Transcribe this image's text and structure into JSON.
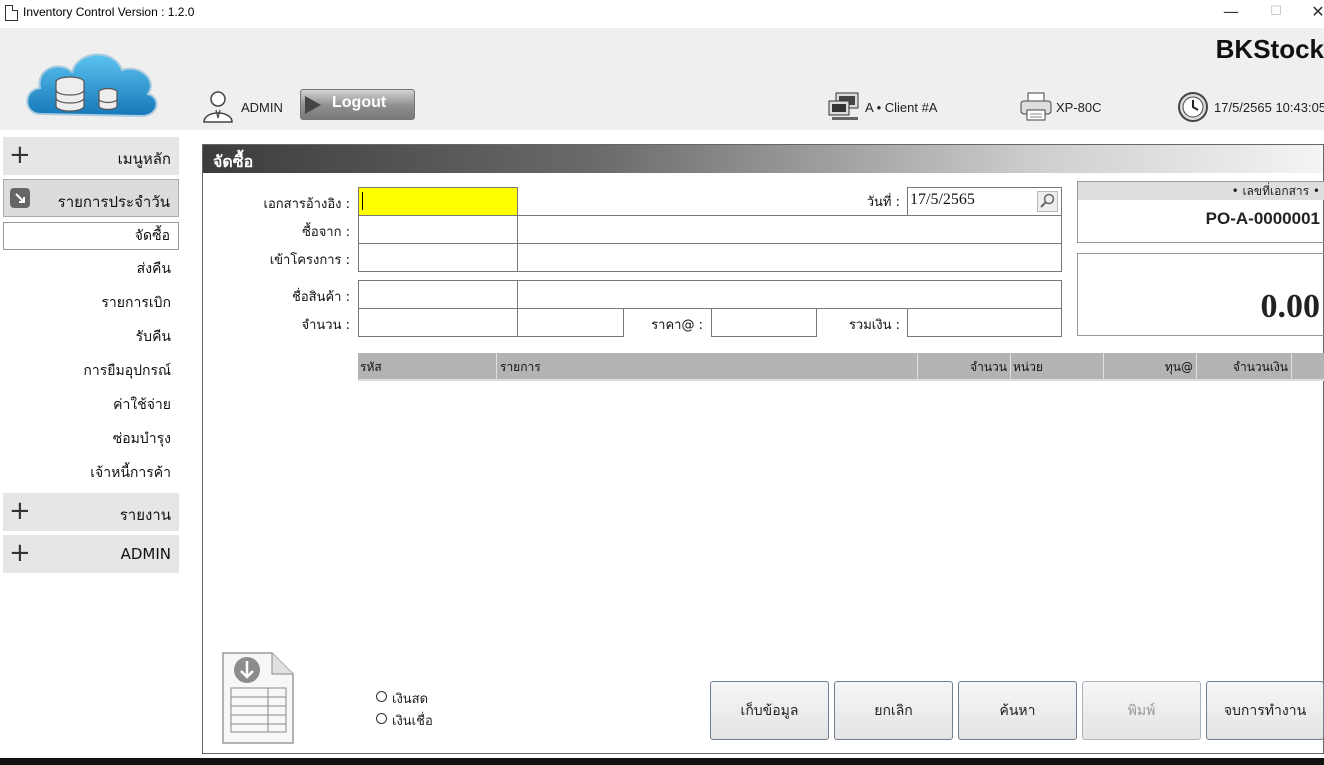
{
  "window": {
    "title": "Inventory Control Version : 1.2.0",
    "minimize": "—",
    "maximize": "☐",
    "close": "✕"
  },
  "header": {
    "brand": "BKStock",
    "user": "ADMIN",
    "logout_label": "Logout",
    "client": "A • Client #A",
    "printer": "XP-80C",
    "datetime": "17/5/2565 10:43:05"
  },
  "sidebar": {
    "main_menu": "เมนูหลัก",
    "daily": "รายการประจำวัน",
    "items": [
      "จัดซื้อ",
      "ส่งคืน",
      "รายการเบิก",
      "รับคืน",
      "การยืมอุปกรณ์",
      "ค่าใช้จ่าย",
      "ซ่อมบำรุง",
      "เจ้าหนี้การค้า"
    ],
    "report": "รายงาน",
    "admin": "ADMIN"
  },
  "form": {
    "title": "จัดซื้อ",
    "ref_label": "เอกสารอ้างอิง :",
    "ref_value": "",
    "date_label": "วันที่ :",
    "date_value": "17/5/2565",
    "buy_from_label": "ซื้อจาก :",
    "project_label": "เข้าโครงการ :",
    "product_label": "ชื่อสินค้า :",
    "qty_label": "จำนวน :",
    "price_label": "ราคา@ :",
    "sum_label": "รวมเงิน :",
    "doc_no_label": "• เลขที่เอกสาร •",
    "doc_no": "PO-A-0000001",
    "total": "0.00"
  },
  "table": {
    "columns": [
      "รหัส",
      "รายการ",
      "จำนวน",
      "หน่วย",
      "ทุน@",
      "จำนวนเงิน"
    ]
  },
  "payment": {
    "cash": "เงินสด",
    "credit": "เงินเชื่อ"
  },
  "actions": {
    "save": "เก็บข้อมูล",
    "cancel": "ยกเลิก",
    "search": "ค้นหา",
    "print": "พิมพ์",
    "finish": "จบการทำงาน"
  }
}
